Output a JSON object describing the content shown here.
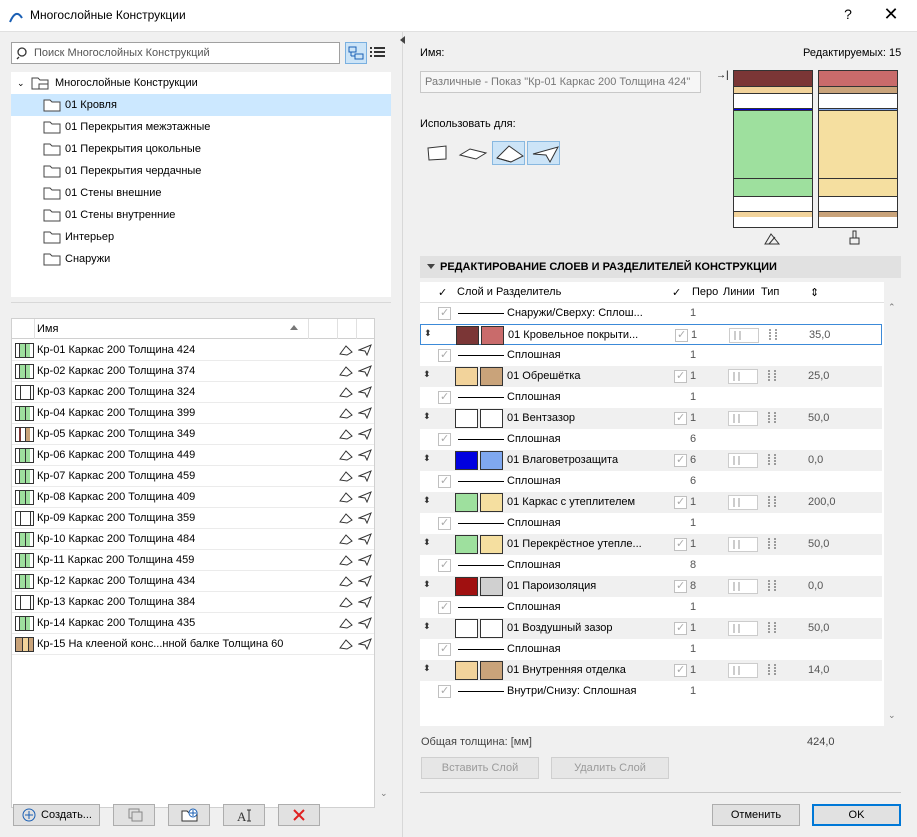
{
  "window": {
    "title": "Многослойные Конструкции",
    "help": "?",
    "close": "✕"
  },
  "search": {
    "placeholder": "Поиск Многослойных Конструкций"
  },
  "tree": {
    "root": "Многослойные Конструкции",
    "items": [
      "01 Кровля",
      "01 Перекрытия межэтажные",
      "01 Перекрытия цокольные",
      "01 Перекрытия чердачные",
      "01 Стены внешние",
      "01 Стены внутренние",
      "Интерьер",
      "Снаружи"
    ],
    "selected_index": 0
  },
  "list": {
    "header": "Имя",
    "rows": [
      {
        "name": "Кр-01 Каркас 200 Толщина 424",
        "swatch": "green"
      },
      {
        "name": "Кр-02 Каркас 200 Толщина 374",
        "swatch": "green"
      },
      {
        "name": "Кр-03 Каркас 200 Толщина 324",
        "swatch": "white"
      },
      {
        "name": "Кр-04 Каркас 200 Толщина 399",
        "swatch": "green"
      },
      {
        "name": "Кр-05 Каркас 200 Толщина 349",
        "swatch": "brown"
      },
      {
        "name": "Кр-06 Каркас 200 Толщина 449",
        "swatch": "green"
      },
      {
        "name": "Кр-07 Каркас 200 Толщина 459",
        "swatch": "green"
      },
      {
        "name": "Кр-08 Каркас 200 Толщина 409",
        "swatch": "green"
      },
      {
        "name": "Кр-09 Каркас 200 Толщина 359",
        "swatch": "white"
      },
      {
        "name": "Кр-10 Каркас 200 Толщина 484",
        "swatch": "green"
      },
      {
        "name": "Кр-11 Каркас 200 Толщина 459",
        "swatch": "green"
      },
      {
        "name": "Кр-12 Каркас 200 Толщина 434",
        "swatch": "green"
      },
      {
        "name": "Кр-13 Каркас 200 Толщина 384",
        "swatch": "white"
      },
      {
        "name": "Кр-14 Каркас 200 Толщина 435",
        "swatch": "green"
      },
      {
        "name": "Кр-15 На клееной конс...нной балке Толщина 60",
        "swatch": "wood"
      }
    ]
  },
  "left_buttons": {
    "create": "Создать..."
  },
  "right": {
    "name_label": "Имя:",
    "editable_label": "Редактируемых: 15",
    "name_value": "Различные - Показ \"Кр-01 Каркас 200 Толщина 424\"",
    "use_for_label": "Использовать для:",
    "section_title": "РЕДАКТИРОВАНИЕ СЛОЕВ И РАЗДЕЛИТЕЛЕЙ КОНСТРУКЦИИ",
    "grid_headers": {
      "layer": "Слой и Разделитель",
      "pen": "Перо",
      "lines": "Линии",
      "type": "Тип"
    },
    "total_label": "Общая толщина: [мм]",
    "total_value": "424,0",
    "insert_layer": "Вставить Слой",
    "delete_layer": "Удалить Слой",
    "cancel": "Отменить",
    "ok": "OK"
  },
  "layers": [
    {
      "kind": "sep",
      "name": "Снаружи/Сверху: Сплош...",
      "pen": "1"
    },
    {
      "kind": "layer",
      "name": "01 Кровельное покрыти...",
      "pen": "1",
      "thk": "35,0",
      "c1": "#7b3636",
      "c2": "#c96b6b",
      "sel": true
    },
    {
      "kind": "sep",
      "name": "Сплошная",
      "pen": "1"
    },
    {
      "kind": "layer",
      "name": "01 Обрешётка",
      "pen": "1",
      "thk": "25,0",
      "c1": "#f2d39b",
      "c2": "#c9a37a"
    },
    {
      "kind": "sep",
      "name": "Сплошная",
      "pen": "1"
    },
    {
      "kind": "layer",
      "name": "01 Вентзазор",
      "pen": "1",
      "thk": "50,0",
      "c1": "#ffffff",
      "c2": "#ffffff"
    },
    {
      "kind": "sep",
      "name": "Сплошная",
      "pen": "6"
    },
    {
      "kind": "layer",
      "name": "01 Влаговетрозащита",
      "pen": "6",
      "thk": "0,0",
      "c1": "#0000e0",
      "c2": "#7fa8f0"
    },
    {
      "kind": "sep",
      "name": "Сплошная",
      "pen": "6"
    },
    {
      "kind": "layer",
      "name": "01 Каркас с утеплителем",
      "pen": "1",
      "thk": "200,0",
      "c1": "#9ee09e",
      "c2": "#f5dfa0"
    },
    {
      "kind": "sep",
      "name": "Сплошная",
      "pen": "1"
    },
    {
      "kind": "layer",
      "name": "01 Перекрёстное утепле...",
      "pen": "1",
      "thk": "50,0",
      "c1": "#9ee09e",
      "c2": "#f5dfa0"
    },
    {
      "kind": "sep",
      "name": "Сплошная",
      "pen": "8"
    },
    {
      "kind": "layer",
      "name": "01 Пароизоляция",
      "pen": "8",
      "thk": "0,0",
      "c1": "#a01010",
      "c2": "#d0d0d0"
    },
    {
      "kind": "sep",
      "name": "Сплошная",
      "pen": "1"
    },
    {
      "kind": "layer",
      "name": "01 Воздушный зазор",
      "pen": "1",
      "thk": "50,0",
      "c1": "#ffffff",
      "c2": "#ffffff"
    },
    {
      "kind": "sep",
      "name": "Сплошная",
      "pen": "1"
    },
    {
      "kind": "layer",
      "name": "01 Внутренняя отделка",
      "pen": "1",
      "thk": "14,0",
      "c1": "#f2d39b",
      "c2": "#c9a37a"
    },
    {
      "kind": "sep",
      "name": "Внутри/Снизу: Сплошная",
      "pen": "1"
    }
  ]
}
